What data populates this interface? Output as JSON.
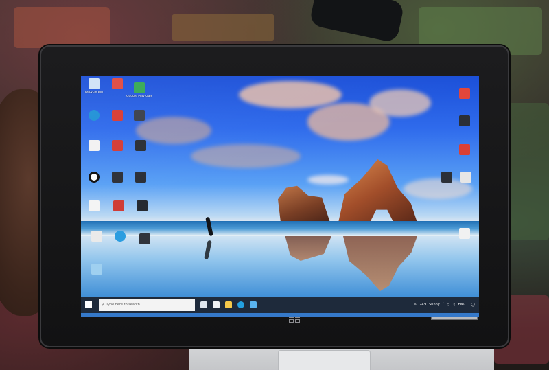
{
  "desktop_icons": [
    {
      "label": "Recycle Bin",
      "icon": "recycle-bin-icon",
      "color": "#cfe3f7"
    },
    {
      "label": "",
      "icon": "pdf-file-icon",
      "color": "#e0483e"
    },
    {
      "label": "Google Play Games beta",
      "icon": "google-play-icon",
      "color": "#34a853"
    },
    {
      "label": "",
      "icon": "edge-browser-icon",
      "color": "#1e90d6"
    },
    {
      "label": "",
      "icon": "pdf-file-icon",
      "color": "#d93a32"
    },
    {
      "label": "",
      "icon": "app-shortcut-icon",
      "color": "#3a3f4a"
    },
    {
      "label": "",
      "icon": "document-icon",
      "color": "#f2f2f2"
    },
    {
      "label": "",
      "icon": "pdf-file-icon",
      "color": "#d43b34"
    },
    {
      "label": "",
      "icon": "video-file-icon",
      "color": "#2a2d33"
    },
    {
      "label": "",
      "icon": "g-app-icon",
      "color": "#ffffff"
    },
    {
      "label": "",
      "icon": "media-file-icon",
      "color": "#2d3038"
    },
    {
      "label": "",
      "icon": "media-file-icon",
      "color": "#2a2e36"
    },
    {
      "label": "",
      "icon": "document-icon",
      "color": "#f4f4f4"
    },
    {
      "label": "",
      "icon": "pdf-file-icon",
      "color": "#cf3c36"
    },
    {
      "label": "",
      "icon": "video-file-icon",
      "color": "#262a31"
    },
    {
      "label": "",
      "icon": "document-icon",
      "color": "#eaeaea"
    },
    {
      "label": "",
      "icon": "sync-app-icon",
      "color": "#2a9de0"
    },
    {
      "label": "",
      "icon": "media-file-icon",
      "color": "#30343c"
    },
    {
      "label": "",
      "icon": "folder-icon",
      "color": "#9fd0f0"
    }
  ],
  "right_icons": [
    {
      "label": "",
      "icon": "pdf-file-icon",
      "color": "#e2463b"
    },
    {
      "label": "",
      "icon": "media-file-icon",
      "color": "#2b2f36"
    },
    {
      "label": "",
      "icon": "pdf-file-icon",
      "color": "#db3f35"
    },
    {
      "label": "",
      "icon": "media-file-icon",
      "color": "#2c3038"
    },
    {
      "label": "",
      "icon": "document-icon",
      "color": "#e6e6e6"
    },
    {
      "label": "",
      "icon": "document-icon",
      "color": "#f1f1f1"
    }
  ],
  "taskbar": {
    "search_placeholder": "Type here to search",
    "weather": "24°C Sunny",
    "lang": "ENG",
    "time": "",
    "date": "",
    "accent": "#1e2a3b"
  }
}
